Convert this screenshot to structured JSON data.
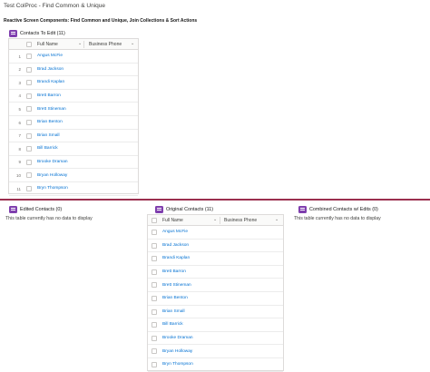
{
  "breadcrumb": "Test ColProc - Find Common & Unique",
  "page_title": "Reactive Screen Components: Find Common and Unique, Join Collections & Sort Actions",
  "top_table": {
    "title": "Contacts To Edit (11)",
    "columns": [
      "Full Name",
      "Business Phone"
    ],
    "rows": [
      {
        "num": "1",
        "name": "Angus McFie"
      },
      {
        "num": "2",
        "name": "Brad Jackson"
      },
      {
        "num": "3",
        "name": "Brandi Kaplan"
      },
      {
        "num": "4",
        "name": "Brett Barron"
      },
      {
        "num": "5",
        "name": "Brett Stineman"
      },
      {
        "num": "6",
        "name": "Brian Benton"
      },
      {
        "num": "7",
        "name": "Brian Small"
      },
      {
        "num": "8",
        "name": "Bill Barrick"
      },
      {
        "num": "9",
        "name": "Brooke Draman"
      },
      {
        "num": "10",
        "name": "Bryan Holloway"
      },
      {
        "num": "11",
        "name": "Bryn Thompson"
      }
    ]
  },
  "edited": {
    "title": "Edited Contacts (0)",
    "empty_message": "This table currently has no data to display"
  },
  "original": {
    "title": "Original Contacts (11)",
    "columns": [
      "Full Name",
      "Business Phone"
    ],
    "rows": [
      "Angus McFie",
      "Brad Jackson",
      "Brandi Kaplan",
      "Brett Barron",
      "Brett Stineman",
      "Brian Benton",
      "Brian Small",
      "Bill Barrick",
      "Brooke Draman",
      "Bryan Holloway",
      "Bryn Thompson"
    ]
  },
  "combined": {
    "title": "Combined Contacts w/ Edits (0)",
    "empty_message": "This table currently has no data to display"
  },
  "colors": {
    "accent": "#7f3fae",
    "link": "#0070d2",
    "divider": "#9b2f4f"
  },
  "icons": {
    "card_icon": "contacts-object-icon",
    "column_menu": "chevron-down-icon"
  }
}
